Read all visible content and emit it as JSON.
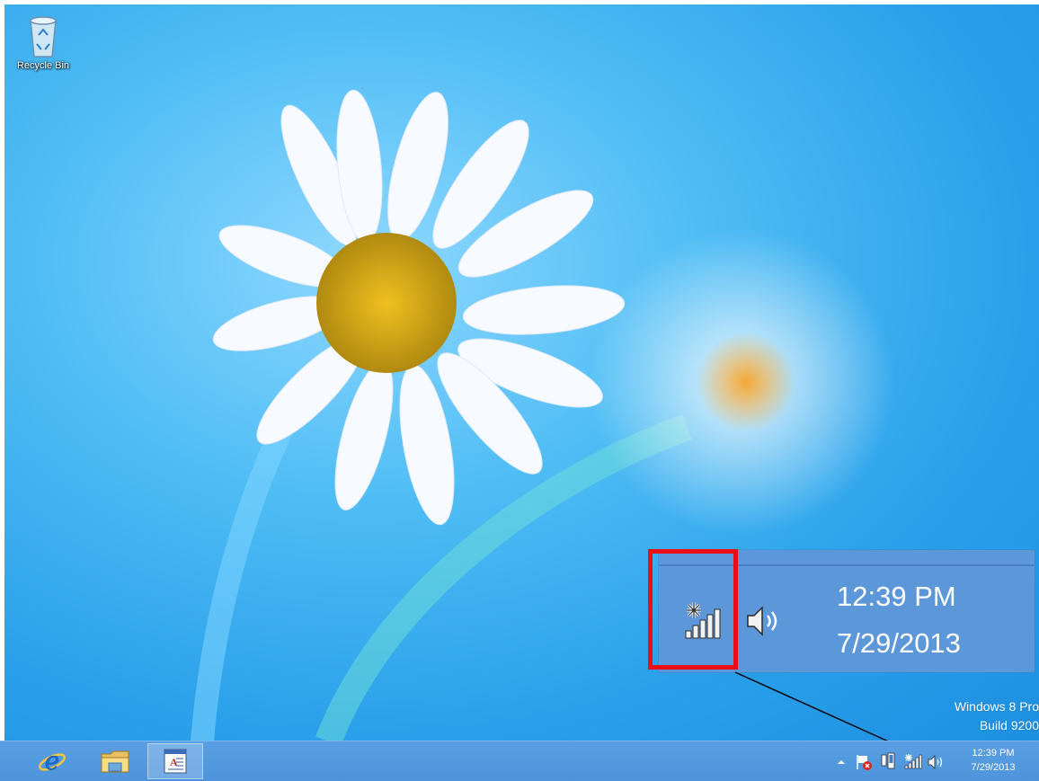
{
  "desktop": {
    "icons": [
      {
        "label": "Recycle Bin",
        "icon": "recycle-bin-icon"
      }
    ],
    "watermark": {
      "line1": "Windows 8 Pro",
      "line2": "Build 9200"
    }
  },
  "callout": {
    "time": "12:39 PM",
    "date": "7/29/2013",
    "icons": [
      "mobile-broadband-signal-icon",
      "volume-icon"
    ],
    "highlight_color": "#ea0f16"
  },
  "taskbar": {
    "pinned": [
      {
        "name": "Internet Explorer",
        "icon": "internet-explorer-icon"
      },
      {
        "name": "File Explorer",
        "icon": "file-explorer-icon"
      },
      {
        "name": "Open application",
        "icon": "document-app-icon",
        "active": true
      }
    ],
    "tray": {
      "icons": [
        "show-hidden-icons-chevron",
        "action-center-flag-icon",
        "phone-device-icon",
        "mobile-broadband-signal-icon",
        "volume-icon"
      ],
      "time": "12:39 PM",
      "date": "7/29/2013"
    },
    "color": "#4d94dc"
  }
}
